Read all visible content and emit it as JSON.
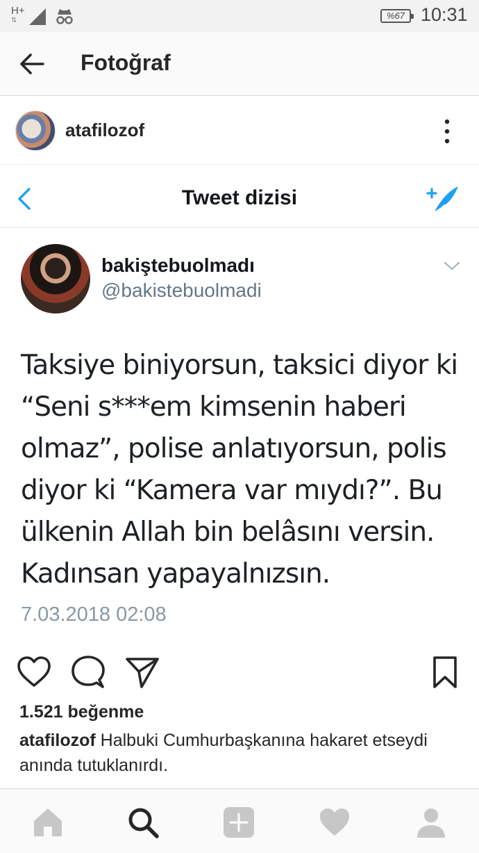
{
  "status_bar": {
    "network": "H+",
    "battery": "%67",
    "time": "10:31"
  },
  "header": {
    "title": "Fotoğraf",
    "back_icon": "arrow-left-icon"
  },
  "post": {
    "username": "atafilozof",
    "more_icon": "more-vertical-icon"
  },
  "tweet": {
    "nav_title": "Tweet dizisi",
    "author_name": "bakiştebuolmadı",
    "author_handle": "@bakistebuolmadi",
    "text": "Taksiye biniyorsun, taksici diyor ki “Seni s***em kimsenin haberi olmaz”, polise anlatıyorsun, polis diyor ki “Kamera var mıydı?”. Bu ülkenin Allah bin belâsını versin. Kadınsan yapayalnızsın.",
    "timestamp": "7.03.2018 02:08",
    "accent_color": "#1da1f2"
  },
  "actions": {
    "like_icon": "heart-icon",
    "comment_icon": "comment-icon",
    "share_icon": "send-icon",
    "save_icon": "bookmark-icon"
  },
  "likes": "1.521 beğenme",
  "caption": {
    "username": "atafilozof",
    "text": "Halbuki Cumhurbaşkanına hakaret etseydi anında tutuklanırdı."
  },
  "tab_bar": {
    "items": [
      "home-icon",
      "search-icon",
      "add-icon",
      "heart-icon",
      "profile-icon"
    ]
  }
}
